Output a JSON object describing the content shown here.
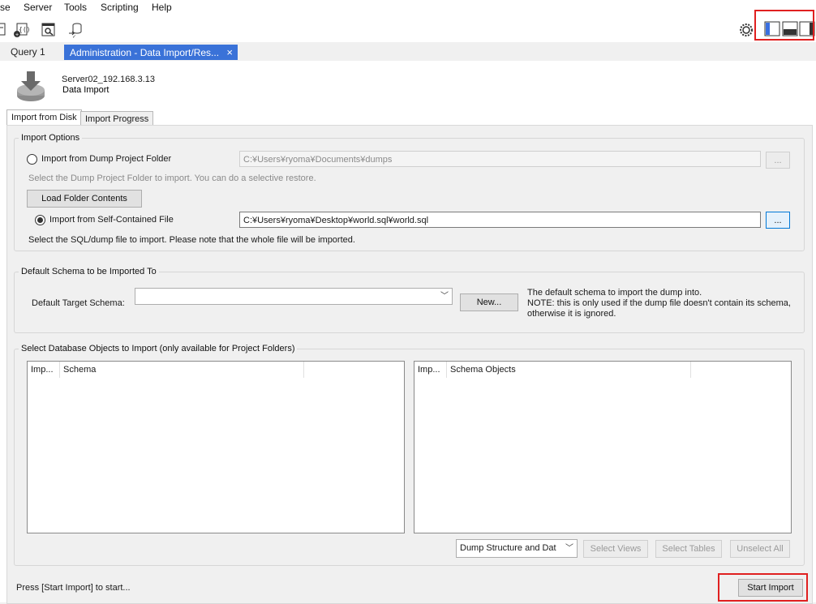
{
  "menu": [
    "se",
    "Server",
    "Tools",
    "Scripting",
    "Help"
  ],
  "tabs": [
    {
      "label": "Query 1"
    },
    {
      "label": "Administration - Data Import/Res...",
      "close": "×"
    }
  ],
  "header": {
    "server": "Server02_192.168.3.13",
    "title": "Data Import"
  },
  "inner_tabs": [
    "Import from Disk",
    "Import Progress"
  ],
  "import_options": {
    "title": "Import Options",
    "dump_folder_label": "Import from Dump Project Folder",
    "dump_folder_path": "C:¥Users¥ryoma¥Documents¥dumps",
    "dump_folder_help": "Select the Dump Project Folder to import. You can do a selective restore.",
    "load_button": "Load Folder Contents",
    "file_label": "Import from Self-Contained File",
    "file_path": "C:¥Users¥ryoma¥Desktop¥world.sql¥world.sql",
    "file_help": "Select the SQL/dump file to import. Please note that the whole file will be imported.",
    "browse": "..."
  },
  "default_schema": {
    "title": "Default Schema to be Imported To",
    "label": "Default Target Schema:",
    "value": "",
    "new_button": "New...",
    "note1": "The default schema to import the dump into.",
    "note2": "NOTE: this is only used if the dump file doesn't contain its schema,",
    "note3": "otherwise it is ignored."
  },
  "objects": {
    "title": "Select Database Objects to Import (only available for Project Folders)",
    "left_cols": [
      "Imp...",
      "Schema"
    ],
    "right_cols": [
      "Imp...",
      "Schema Objects"
    ],
    "dump_select": "Dump Structure and Dat",
    "select_views": "Select Views",
    "select_tables": "Select Tables",
    "unselect_all": "Unselect All"
  },
  "footer": {
    "status": "Press [Start Import] to start...",
    "start_button": "Start Import"
  },
  "colors": {
    "accent": "#4a6fd0",
    "active_tab": "#3a72d8",
    "highlight": "#e02020"
  }
}
